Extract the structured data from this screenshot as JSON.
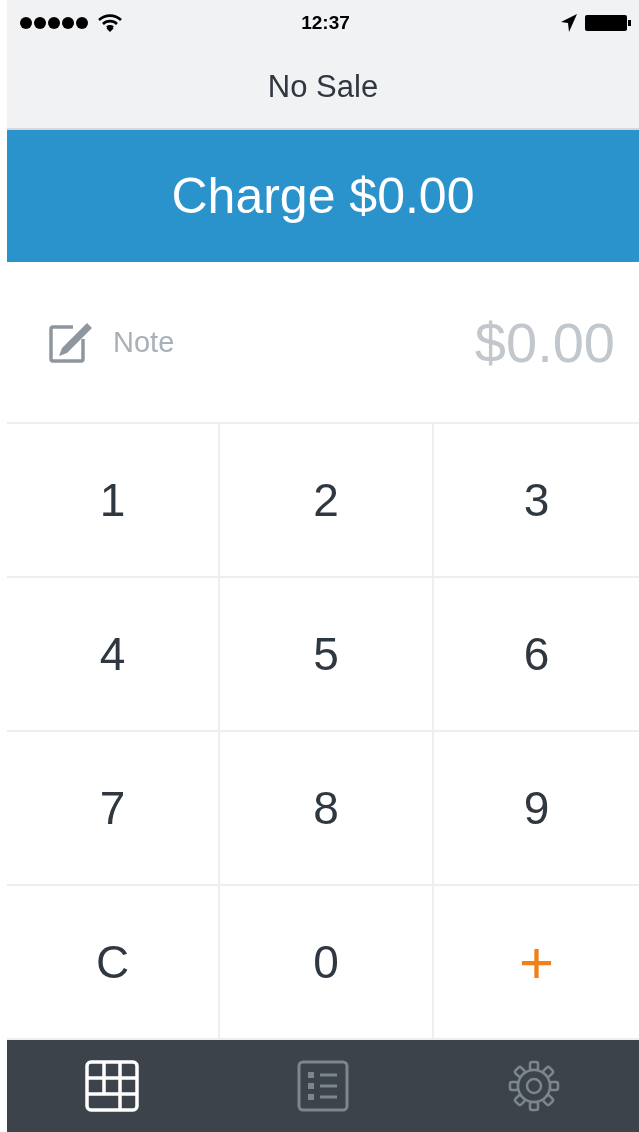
{
  "status_bar": {
    "time": "12:37"
  },
  "nav": {
    "title": "No Sale"
  },
  "charge_button": {
    "label": "Charge $0.00"
  },
  "entry": {
    "note_placeholder": "Note",
    "amount": "$0.00"
  },
  "keypad": [
    {
      "label": "1",
      "kind": "digit"
    },
    {
      "label": "2",
      "kind": "digit"
    },
    {
      "label": "3",
      "kind": "digit"
    },
    {
      "label": "4",
      "kind": "digit"
    },
    {
      "label": "5",
      "kind": "digit"
    },
    {
      "label": "6",
      "kind": "digit"
    },
    {
      "label": "7",
      "kind": "digit"
    },
    {
      "label": "8",
      "kind": "digit"
    },
    {
      "label": "9",
      "kind": "digit"
    },
    {
      "label": "C",
      "kind": "clear"
    },
    {
      "label": "0",
      "kind": "digit"
    },
    {
      "label": "+",
      "kind": "add"
    }
  ],
  "tab_bar": [
    {
      "kind": "keypad",
      "selected": true
    },
    {
      "kind": "library",
      "selected": false
    },
    {
      "kind": "settings",
      "selected": false
    }
  ]
}
